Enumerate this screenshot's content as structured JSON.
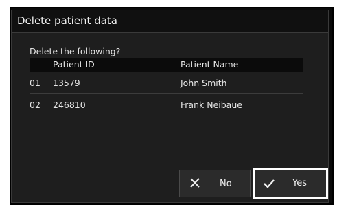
{
  "dialog": {
    "title": "Delete patient data",
    "prompt": "Delete the following?"
  },
  "table": {
    "headers": {
      "id": "Patient ID",
      "name": "Patient Name"
    },
    "rows": [
      {
        "no": "01",
        "id": "13579",
        "name": "John Smith"
      },
      {
        "no": "02",
        "id": "246810",
        "name": "Frank Neibaue"
      }
    ]
  },
  "buttons": {
    "no_label": "No",
    "yes_label": "Yes",
    "no_icon": "close-icon",
    "yes_icon": "check-icon"
  }
}
